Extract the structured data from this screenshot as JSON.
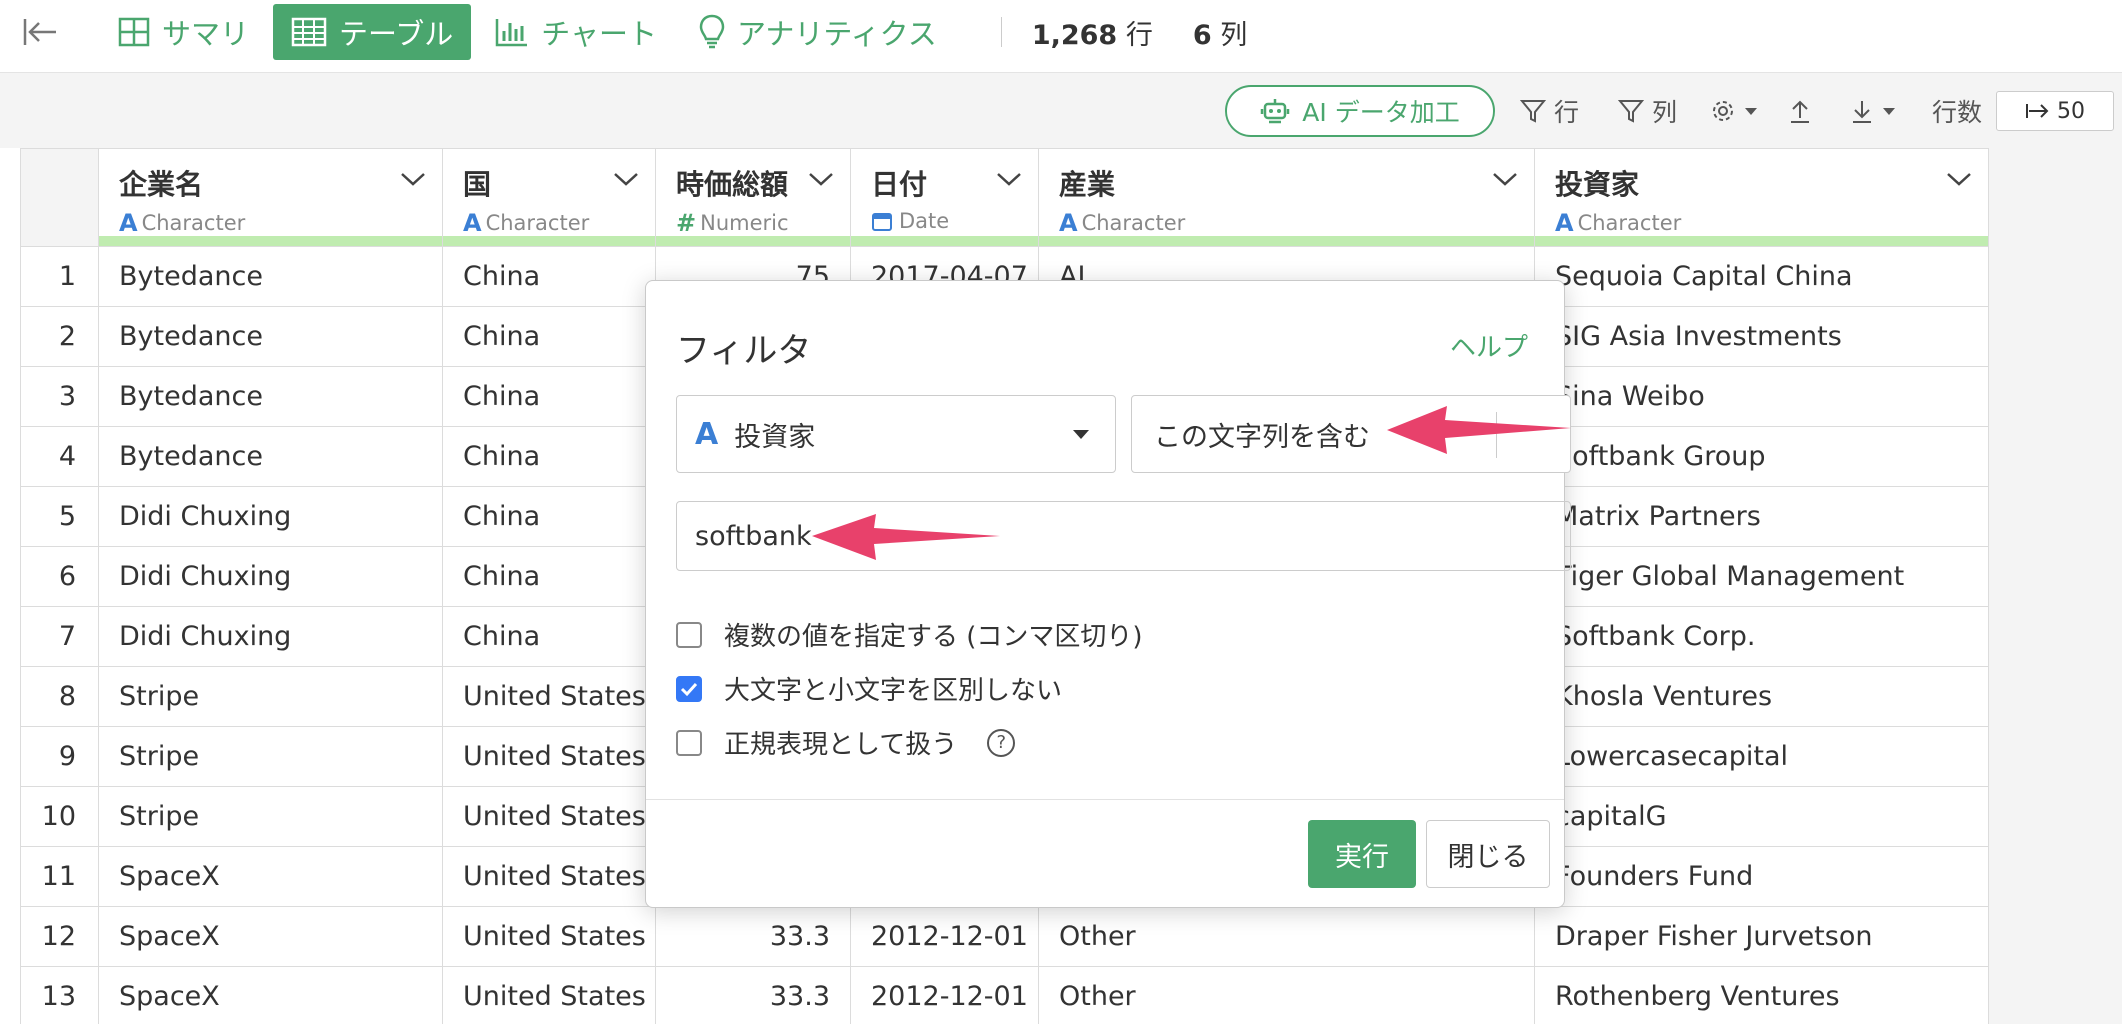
{
  "nav": {
    "tabs": [
      {
        "label": "サマリ",
        "icon": "summary-grid-icon"
      },
      {
        "label": "テーブル",
        "icon": "table-icon"
      },
      {
        "label": "チャート",
        "icon": "bar-chart-icon"
      },
      {
        "label": "アナリティクス",
        "icon": "lightbulb-icon"
      }
    ],
    "row_count": "1,268",
    "row_unit": "行",
    "col_count": "6",
    "col_unit": "列"
  },
  "toolbar": {
    "ai_label": "AI データ加工",
    "row_filter": "行",
    "col_filter": "列",
    "rows_label": "行数",
    "rows_value": "50"
  },
  "columns": [
    {
      "name": "企業名",
      "type": "Character",
      "type_icon": "A"
    },
    {
      "name": "国",
      "type": "Character",
      "type_icon": "A"
    },
    {
      "name": "時価総額",
      "type": "Numeric",
      "type_icon": "#"
    },
    {
      "name": "日付",
      "type": "Date",
      "type_icon": "calendar"
    },
    {
      "name": "産業",
      "type": "Character",
      "type_icon": "A"
    },
    {
      "name": "投資家",
      "type": "Character",
      "type_icon": "A"
    }
  ],
  "rows": [
    [
      "1",
      "Bytedance",
      "China",
      "75",
      "2017-04-07",
      "AI",
      "Sequoia Capital China"
    ],
    [
      "2",
      "Bytedance",
      "China",
      "",
      "",
      "",
      "SIG Asia Investments"
    ],
    [
      "3",
      "Bytedance",
      "China",
      "",
      "",
      "",
      "Sina Weibo"
    ],
    [
      "4",
      "Bytedance",
      "China",
      "",
      "",
      "",
      "Softbank Group"
    ],
    [
      "5",
      "Didi Chuxing",
      "China",
      "",
      "",
      "",
      "Matrix Partners"
    ],
    [
      "6",
      "Didi Chuxing",
      "China",
      "",
      "",
      "",
      "Tiger Global Management"
    ],
    [
      "7",
      "Didi Chuxing",
      "China",
      "",
      "",
      "",
      "Softbank Corp."
    ],
    [
      "8",
      "Stripe",
      "United States",
      "",
      "",
      "",
      "Khosla Ventures"
    ],
    [
      "9",
      "Stripe",
      "United States",
      "",
      "",
      "",
      "Lowercasecapital"
    ],
    [
      "10",
      "Stripe",
      "United States",
      "",
      "",
      "",
      "capitalG"
    ],
    [
      "11",
      "SpaceX",
      "United States",
      "",
      "",
      "",
      "Founders Fund"
    ],
    [
      "12",
      "SpaceX",
      "United States",
      "33.3",
      "2012-12-01",
      "Other",
      "Draper Fisher Jurvetson"
    ],
    [
      "13",
      "SpaceX",
      "United States",
      "33.3",
      "2012-12-01",
      "Other",
      "Rothenberg Ventures"
    ]
  ],
  "filter_dialog": {
    "title": "フィルタ",
    "help": "ヘルプ",
    "column": "投資家",
    "operator": "この文字列を含む",
    "value": "softbank",
    "options": [
      {
        "label": "複数の値を指定する (コンマ区切り)",
        "checked": false
      },
      {
        "label": "大文字と小文字を区別しない",
        "checked": true
      },
      {
        "label": "正規表現として扱う",
        "checked": false
      }
    ],
    "run": "実行",
    "close": "閉じる"
  }
}
